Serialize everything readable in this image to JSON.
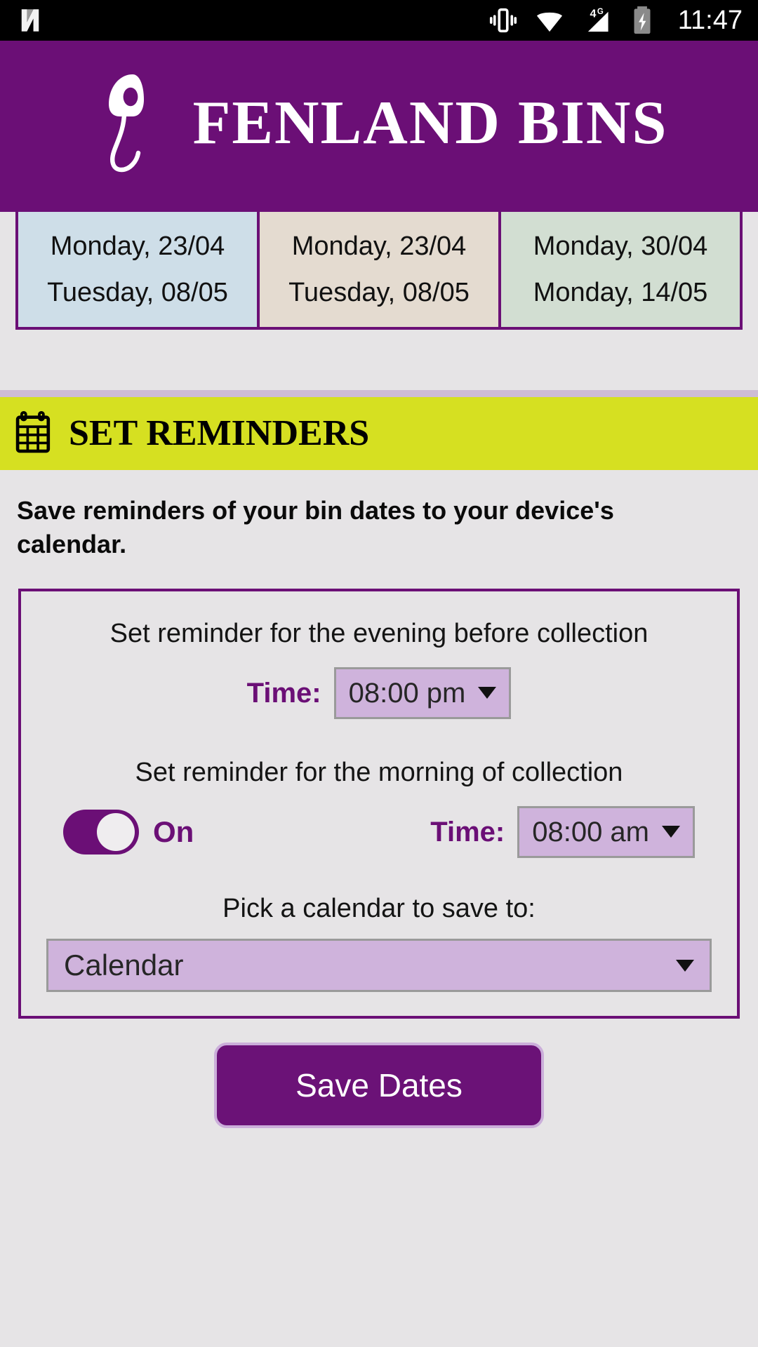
{
  "status_bar": {
    "time": "11:47",
    "icons": [
      "android-n-logo",
      "vibrate-icon",
      "wifi-icon",
      "signal-4g-icon",
      "battery-charging-icon"
    ],
    "network_label": "4G"
  },
  "header": {
    "title": "FENLAND BINS",
    "logo": "fenland-swan-logo",
    "bg_color": "#6B0F76"
  },
  "collections": {
    "columns": [
      {
        "name": "blue-bin",
        "bg_color": "#CEDEE8",
        "dates": [
          "Monday, 23/04",
          "Tuesday, 08/05"
        ]
      },
      {
        "name": "brown-bin",
        "bg_color": "#E4DBD0",
        "dates": [
          "Monday, 23/04",
          "Tuesday, 08/05"
        ]
      },
      {
        "name": "green-bin",
        "bg_color": "#D2DED2",
        "dates": [
          "Monday, 30/04",
          "Monday, 14/05"
        ]
      }
    ]
  },
  "reminders_section": {
    "banner_title": "SET REMINDERS",
    "banner_icon": "calendar-icon",
    "banner_color": "#D6E021",
    "description": "Save reminders of your bin dates to your device's calendar.",
    "evening": {
      "label": "Set reminder for the evening before collection",
      "time_label": "Time:",
      "time_value": "08:00 pm"
    },
    "morning": {
      "label": "Set reminder for the morning of collection",
      "toggle_state": "On",
      "time_label": "Time:",
      "time_value": "08:00 am"
    },
    "calendar_picker": {
      "label": "Pick a calendar to save to:",
      "value": "Calendar"
    },
    "save_button": "Save Dates",
    "accent_color": "#6B0F76"
  }
}
